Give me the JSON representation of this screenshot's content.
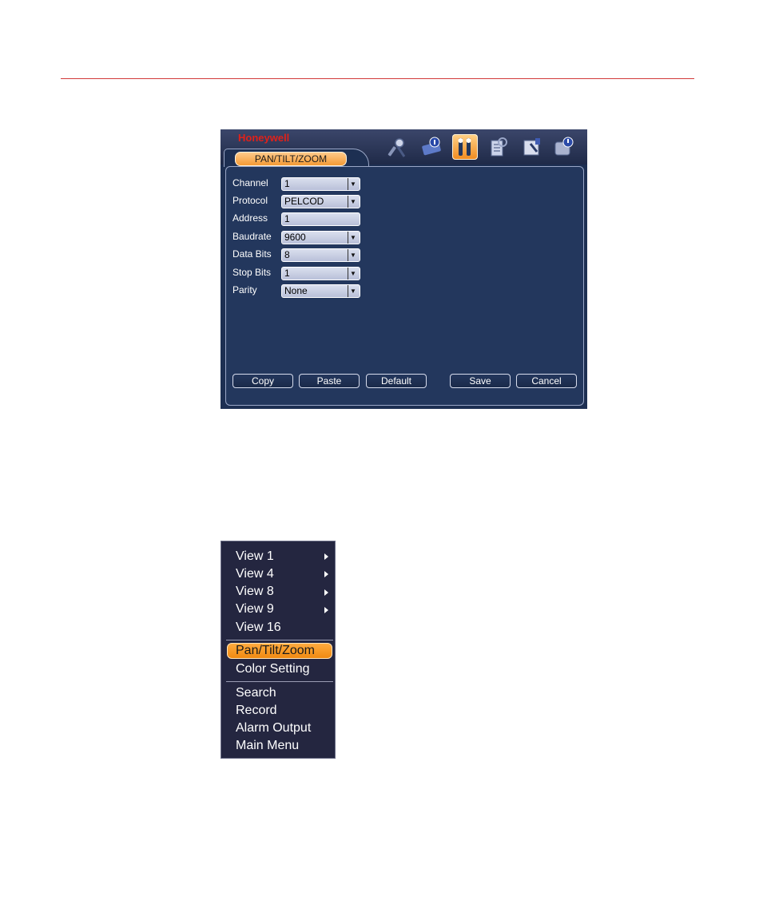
{
  "dialog": {
    "brand": "Honeywell",
    "tab_label": "PAN/TILT/ZOOM",
    "toolbar_icons": [
      "search-camera-icon",
      "info-icon",
      "tools-icon",
      "advanced-icon",
      "backup-icon",
      "shutdown-icon"
    ],
    "active_icon": "tools-icon",
    "fields": [
      {
        "label": "Channel",
        "value": "1"
      },
      {
        "label": "Protocol",
        "value": "PELCOD"
      },
      {
        "label": "Address",
        "value": "1"
      },
      {
        "label": "Baudrate",
        "value": "9600"
      },
      {
        "label": "Data Bits",
        "value": "8"
      },
      {
        "label": "Stop Bits",
        "value": "1"
      },
      {
        "label": "Parity",
        "value": "None"
      }
    ],
    "buttons": {
      "copy": "Copy",
      "paste": "Paste",
      "default": "Default",
      "save": "Save",
      "cancel": "Cancel"
    }
  },
  "context_menu": {
    "items": [
      {
        "label": "View 1",
        "submenu": true
      },
      {
        "label": "View 4",
        "submenu": true
      },
      {
        "label": "View 8",
        "submenu": true
      },
      {
        "label": "View 9",
        "submenu": true
      },
      {
        "label": "View 16",
        "submenu": false
      },
      {
        "label": "Pan/Tilt/Zoom",
        "submenu": false
      },
      {
        "label": "Color Setting",
        "submenu": false
      },
      {
        "label": "Search",
        "submenu": false
      },
      {
        "label": "Record",
        "submenu": false
      },
      {
        "label": "Alarm Output",
        "submenu": false
      },
      {
        "label": "Main Menu",
        "submenu": false
      }
    ],
    "highlighted": "Pan/Tilt/Zoom"
  },
  "colors": {
    "page_rule": "#d23a3a",
    "brand": "#e0211a",
    "accent": "#f39a35",
    "panel": "#1d2f52"
  }
}
